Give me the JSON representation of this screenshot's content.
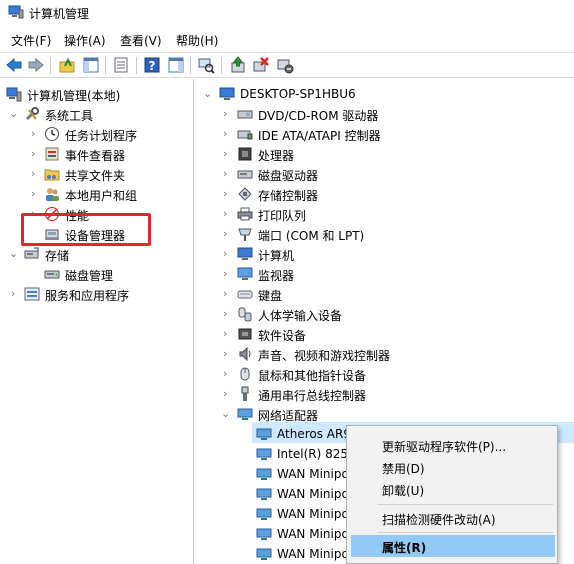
{
  "window": {
    "title": "计算机管理"
  },
  "menu": [
    {
      "label": "文件(F)"
    },
    {
      "label": "操作(A)"
    },
    {
      "label": "查看(V)"
    },
    {
      "label": "帮助(H)"
    }
  ],
  "left_tree": {
    "root": "计算机管理(本地)",
    "system_tools": "系统工具",
    "task_scheduler": "任务计划程序",
    "event_viewer": "事件查看器",
    "shared_folders": "共享文件夹",
    "local_users": "本地用户和组",
    "performance": "性能",
    "device_manager": "设备管理器",
    "storage": "存储",
    "disk_management": "磁盘管理",
    "services": "服务和应用程序"
  },
  "right_tree": {
    "computer": "DESKTOP-SP1HBU6",
    "categories": [
      "DVD/CD-ROM 驱动器",
      "IDE ATA/ATAPI 控制器",
      "处理器",
      "磁盘驱动器",
      "存储控制器",
      "打印队列",
      "端口 (COM 和 LPT)",
      "计算机",
      "监视器",
      "键盘",
      "人体学输入设备",
      "软件设备",
      "声音、视频和游戏控制器",
      "鼠标和其他指针设备",
      "通用串行总线控制器",
      "网络适配器"
    ],
    "network_adapters": [
      "Atheros AR9271 Wireless Network Adapt",
      "Intel(R) 82567",
      "WAN Minipo",
      "WAN Minipo",
      "WAN Minipo",
      "WAN Minipo",
      "WAN Minipo"
    ]
  },
  "context_menu": {
    "update_driver": "更新驱动程序软件(P)...",
    "disable": "禁用(D)",
    "uninstall": "卸载(U)",
    "scan": "扫描检测硬件改动(A)",
    "properties": "属性(R)"
  }
}
